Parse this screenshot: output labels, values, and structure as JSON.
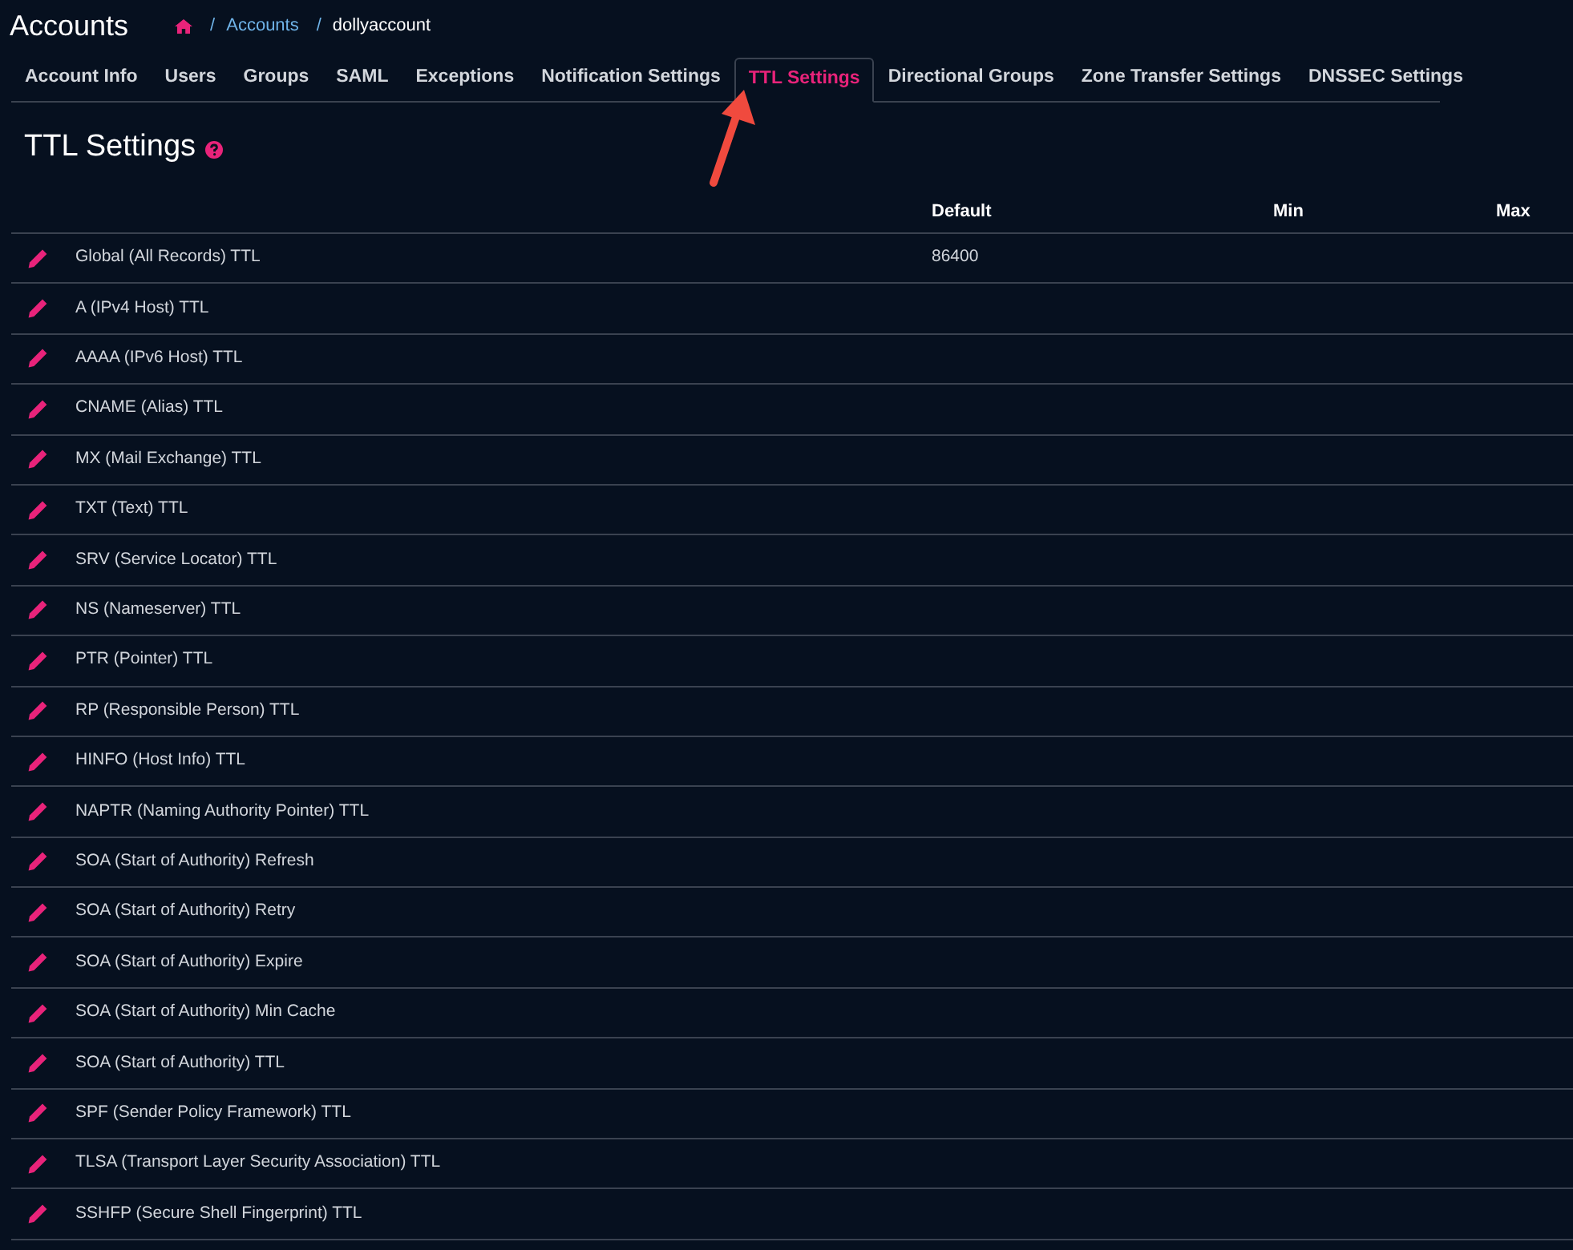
{
  "page_title": "Accounts",
  "breadcrumb": [
    {
      "separator": "/",
      "label": "Accounts",
      "kind": "link"
    },
    {
      "separator": "/",
      "label": "dollyaccount",
      "kind": "current"
    }
  ],
  "tabs": [
    {
      "label": "Account Info",
      "selected": false
    },
    {
      "label": "Users",
      "selected": false
    },
    {
      "label": "Groups",
      "selected": false
    },
    {
      "label": "SAML",
      "selected": false
    },
    {
      "label": "Exceptions",
      "selected": false
    },
    {
      "label": "Notification Settings",
      "selected": false
    },
    {
      "label": "TTL Settings",
      "selected": true
    },
    {
      "label": "Directional Groups",
      "selected": false
    },
    {
      "label": "Zone Transfer Settings",
      "selected": false
    },
    {
      "label": "DNSSEC Settings",
      "selected": false
    }
  ],
  "section_title": "TTL Settings",
  "table": {
    "columns": [
      "Default",
      "Min",
      "Max"
    ],
    "rows": [
      {
        "name": "Global (All Records) TTL",
        "default": "86400"
      },
      {
        "name": "A (IPv4 Host) TTL"
      },
      {
        "name": "AAAA (IPv6 Host) TTL"
      },
      {
        "name": "CNAME (Alias) TTL"
      },
      {
        "name": "MX (Mail Exchange) TTL"
      },
      {
        "name": "TXT (Text) TTL"
      },
      {
        "name": "SRV (Service Locator) TTL"
      },
      {
        "name": "NS (Nameserver) TTL"
      },
      {
        "name": "PTR (Pointer) TTL"
      },
      {
        "name": "RP (Responsible Person) TTL"
      },
      {
        "name": "HINFO (Host Info) TTL"
      },
      {
        "name": "NAPTR (Naming Authority Pointer) TTL"
      },
      {
        "name": "SOA (Start of Authority) Refresh"
      },
      {
        "name": "SOA (Start of Authority) Retry"
      },
      {
        "name": "SOA (Start of Authority) Expire"
      },
      {
        "name": "SOA (Start of Authority) Min Cache"
      },
      {
        "name": "SOA (Start of Authority) TTL"
      },
      {
        "name": "SPF (Sender Policy Framework) TTL"
      },
      {
        "name": "TLSA (Transport Layer Security Association) TTL"
      },
      {
        "name": "SSHFP (Secure Shell Fingerprint) TTL"
      }
    ]
  }
}
